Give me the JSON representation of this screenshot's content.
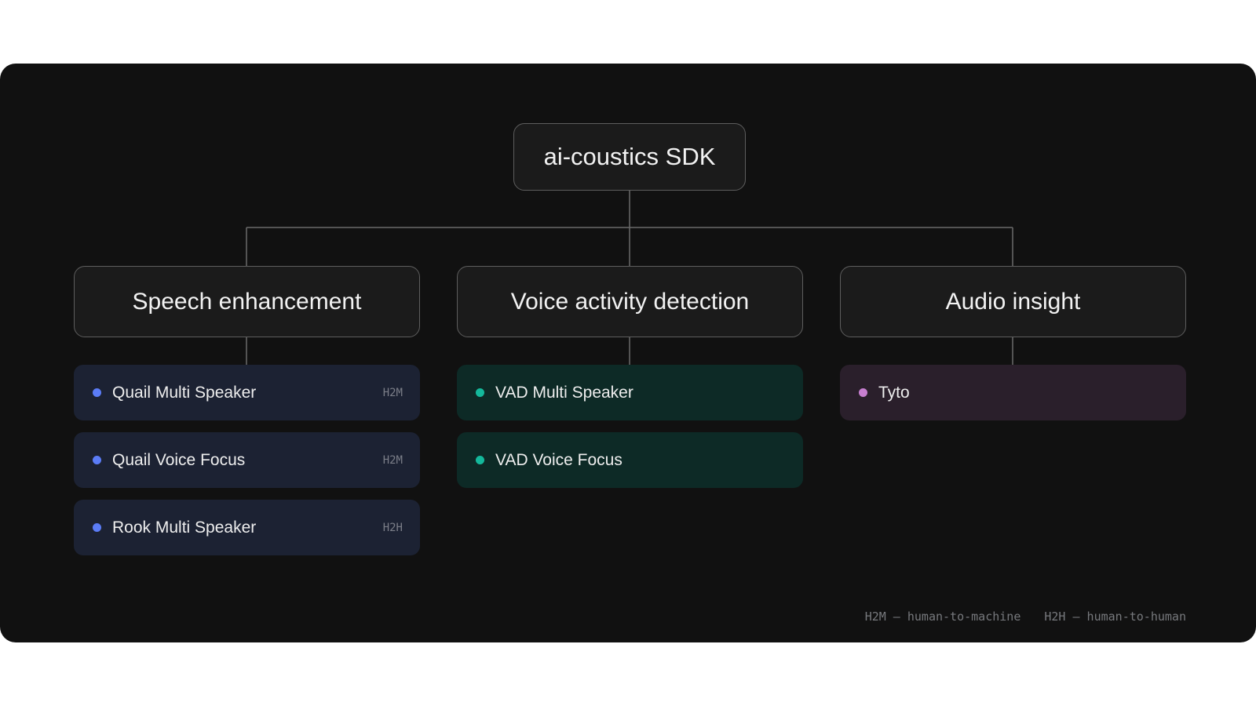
{
  "root": {
    "label": "ai-coustics SDK"
  },
  "categories": [
    {
      "label": "Speech enhancement",
      "color": "#5b7cf6",
      "items": [
        {
          "label": "Quail Multi Speaker",
          "tag": "H2M"
        },
        {
          "label": "Quail Voice Focus",
          "tag": "H2M"
        },
        {
          "label": "Rook Multi Speaker",
          "tag": "H2H"
        }
      ]
    },
    {
      "label": "Voice activity detection",
      "color": "#14b89b",
      "items": [
        {
          "label": "VAD Multi Speaker"
        },
        {
          "label": "VAD Voice Focus"
        }
      ]
    },
    {
      "label": "Audio insight",
      "color": "#c77fd0",
      "items": [
        {
          "label": "Tyto"
        }
      ]
    }
  ],
  "legend": {
    "h2m": "H2M — human-to-machine",
    "h2h": "H2H — human-to-human"
  }
}
